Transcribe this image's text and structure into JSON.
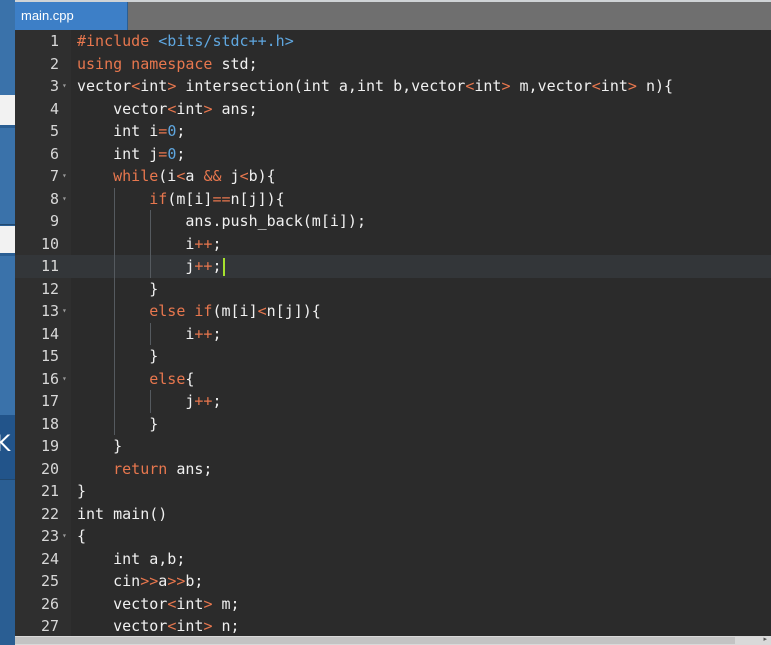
{
  "tab": {
    "filename": "main.cpp"
  },
  "left_panel": {
    "chevron": "K"
  },
  "editor": {
    "active_line": 11,
    "lines": [
      {
        "n": "1",
        "fold": false,
        "tokens": [
          [
            "inc",
            "#include "
          ],
          [
            "hdr",
            "<bits/stdc++.h>"
          ]
        ]
      },
      {
        "n": "2",
        "fold": false,
        "tokens": [
          [
            "kw",
            "using namespace"
          ],
          [
            "txt",
            " std;"
          ]
        ]
      },
      {
        "n": "3",
        "fold": true,
        "tokens": [
          [
            "txt",
            "vector"
          ],
          [
            "op",
            "<"
          ],
          [
            "txt",
            "int"
          ],
          [
            "op",
            ">"
          ],
          [
            "txt",
            " intersection(int a,int b,vector"
          ],
          [
            "op",
            "<"
          ],
          [
            "txt",
            "int"
          ],
          [
            "op",
            ">"
          ],
          [
            "txt",
            " m,vector"
          ],
          [
            "op",
            "<"
          ],
          [
            "txt",
            "int"
          ],
          [
            "op",
            ">"
          ],
          [
            "txt",
            " n){"
          ]
        ]
      },
      {
        "n": "4",
        "fold": false,
        "tokens": [
          [
            "txt",
            "    vector"
          ],
          [
            "op",
            "<"
          ],
          [
            "txt",
            "int"
          ],
          [
            "op",
            ">"
          ],
          [
            "txt",
            " ans;"
          ]
        ]
      },
      {
        "n": "5",
        "fold": false,
        "tokens": [
          [
            "txt",
            "    int i"
          ],
          [
            "op",
            "="
          ],
          [
            "num",
            "0"
          ],
          [
            "txt",
            ";"
          ]
        ]
      },
      {
        "n": "6",
        "fold": false,
        "tokens": [
          [
            "txt",
            "    int j"
          ],
          [
            "op",
            "="
          ],
          [
            "num",
            "0"
          ],
          [
            "txt",
            ";"
          ]
        ]
      },
      {
        "n": "7",
        "fold": true,
        "tokens": [
          [
            "kw",
            "    while"
          ],
          [
            "txt",
            "(i"
          ],
          [
            "op",
            "<"
          ],
          [
            "txt",
            "a "
          ],
          [
            "op",
            "&&"
          ],
          [
            "txt",
            " j"
          ],
          [
            "op",
            "<"
          ],
          [
            "txt",
            "b){"
          ]
        ]
      },
      {
        "n": "8",
        "fold": true,
        "tokens": [
          [
            "kw",
            "        if"
          ],
          [
            "txt",
            "(m[i]"
          ],
          [
            "op",
            "=="
          ],
          [
            "txt",
            "n[j]){"
          ]
        ]
      },
      {
        "n": "9",
        "fold": false,
        "tokens": [
          [
            "txt",
            "            ans.push_back(m[i]);"
          ]
        ]
      },
      {
        "n": "10",
        "fold": false,
        "tokens": [
          [
            "txt",
            "            i"
          ],
          [
            "op",
            "++"
          ],
          [
            "txt",
            ";"
          ]
        ]
      },
      {
        "n": "11",
        "fold": false,
        "tokens": [
          [
            "txt",
            "            j"
          ],
          [
            "op",
            "++"
          ],
          [
            "txt",
            ";"
          ]
        ]
      },
      {
        "n": "12",
        "fold": false,
        "tokens": [
          [
            "txt",
            "        }"
          ]
        ]
      },
      {
        "n": "13",
        "fold": true,
        "tokens": [
          [
            "kw",
            "        else if"
          ],
          [
            "txt",
            "(m[i]"
          ],
          [
            "op",
            "<"
          ],
          [
            "txt",
            "n[j]){"
          ]
        ]
      },
      {
        "n": "14",
        "fold": false,
        "tokens": [
          [
            "txt",
            "            i"
          ],
          [
            "op",
            "++"
          ],
          [
            "txt",
            ";"
          ]
        ]
      },
      {
        "n": "15",
        "fold": false,
        "tokens": [
          [
            "txt",
            "        }"
          ]
        ]
      },
      {
        "n": "16",
        "fold": true,
        "tokens": [
          [
            "kw",
            "        else"
          ],
          [
            "txt",
            "{"
          ]
        ]
      },
      {
        "n": "17",
        "fold": false,
        "tokens": [
          [
            "txt",
            "            j"
          ],
          [
            "op",
            "++"
          ],
          [
            "txt",
            ";"
          ]
        ]
      },
      {
        "n": "18",
        "fold": false,
        "tokens": [
          [
            "txt",
            "        }"
          ]
        ]
      },
      {
        "n": "19",
        "fold": false,
        "tokens": [
          [
            "txt",
            "    }"
          ]
        ]
      },
      {
        "n": "20",
        "fold": false,
        "tokens": [
          [
            "kw",
            "    return"
          ],
          [
            "txt",
            " ans;"
          ]
        ]
      },
      {
        "n": "21",
        "fold": false,
        "tokens": [
          [
            "txt",
            "}"
          ]
        ]
      },
      {
        "n": "22",
        "fold": false,
        "tokens": [
          [
            "txt",
            "int main()"
          ]
        ]
      },
      {
        "n": "23",
        "fold": true,
        "tokens": [
          [
            "txt",
            "{"
          ]
        ]
      },
      {
        "n": "24",
        "fold": false,
        "tokens": [
          [
            "txt",
            "    int a,b;"
          ]
        ]
      },
      {
        "n": "25",
        "fold": false,
        "tokens": [
          [
            "txt",
            "    cin"
          ],
          [
            "op",
            ">>"
          ],
          [
            "txt",
            "a"
          ],
          [
            "op",
            ">>"
          ],
          [
            "txt",
            "b;"
          ]
        ]
      },
      {
        "n": "26",
        "fold": false,
        "tokens": [
          [
            "txt",
            "    vector"
          ],
          [
            "op",
            "<"
          ],
          [
            "txt",
            "int"
          ],
          [
            "op",
            ">"
          ],
          [
            "txt",
            " m;"
          ]
        ]
      },
      {
        "n": "27",
        "fold": false,
        "tokens": [
          [
            "txt",
            "    vector"
          ],
          [
            "op",
            "<"
          ],
          [
            "txt",
            "int"
          ],
          [
            "op",
            ">"
          ],
          [
            "txt",
            " n;"
          ]
        ]
      }
    ]
  },
  "colors": {
    "background": "#2b2b2b",
    "keyword": "#e8774e",
    "header": "#5fa7e0",
    "number": "#5fa7e0",
    "text": "#f0f0f0",
    "line_number": "#d8d8d8",
    "tab_active": "#3d7fc7",
    "cursor": "#a6e22e"
  }
}
